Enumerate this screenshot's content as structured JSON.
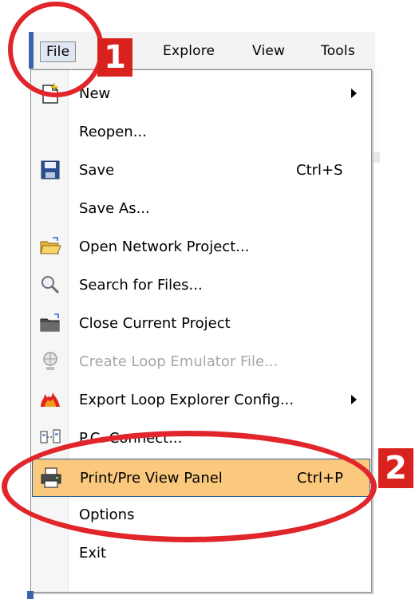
{
  "menubar": {
    "items": [
      {
        "label": "File",
        "mnemonic": "F"
      },
      {
        "label": "Explore"
      },
      {
        "label": "View"
      },
      {
        "label": "Tools"
      }
    ]
  },
  "file_menu": {
    "items": [
      {
        "label": "New",
        "icon": "new-file-icon",
        "submenu": true
      },
      {
        "label": "Reopen..."
      },
      {
        "label": "Save",
        "icon": "floppy-disk-icon",
        "shortcut": "Ctrl+S"
      },
      {
        "label": "Save As..."
      },
      {
        "label": "Open Network Project...",
        "icon": "open-folder-icon"
      },
      {
        "label": "Search for Files...",
        "icon": "magnifier-icon"
      },
      {
        "label": "Close Current Project",
        "icon": "close-folder-icon"
      },
      {
        "label": "Create Loop Emulator File...",
        "icon": "globe-icon",
        "disabled": true
      },
      {
        "label": "Export Loop Explorer Config...",
        "icon": "fire-icon",
        "submenu": true
      },
      {
        "label": "P.C. Connect...",
        "icon": "network-icon"
      },
      {
        "label": "Print/Pre View Panel",
        "icon": "printer-icon",
        "shortcut": "Ctrl+P",
        "highlighted": true
      },
      {
        "label": "Options"
      },
      {
        "label": "Exit"
      }
    ]
  },
  "annotations": {
    "step1": "1",
    "step2": "2"
  },
  "colors": {
    "highlight": "#fbc97e",
    "annotation_red": "#e0252b",
    "disabled_text": "#a7a7a7"
  }
}
